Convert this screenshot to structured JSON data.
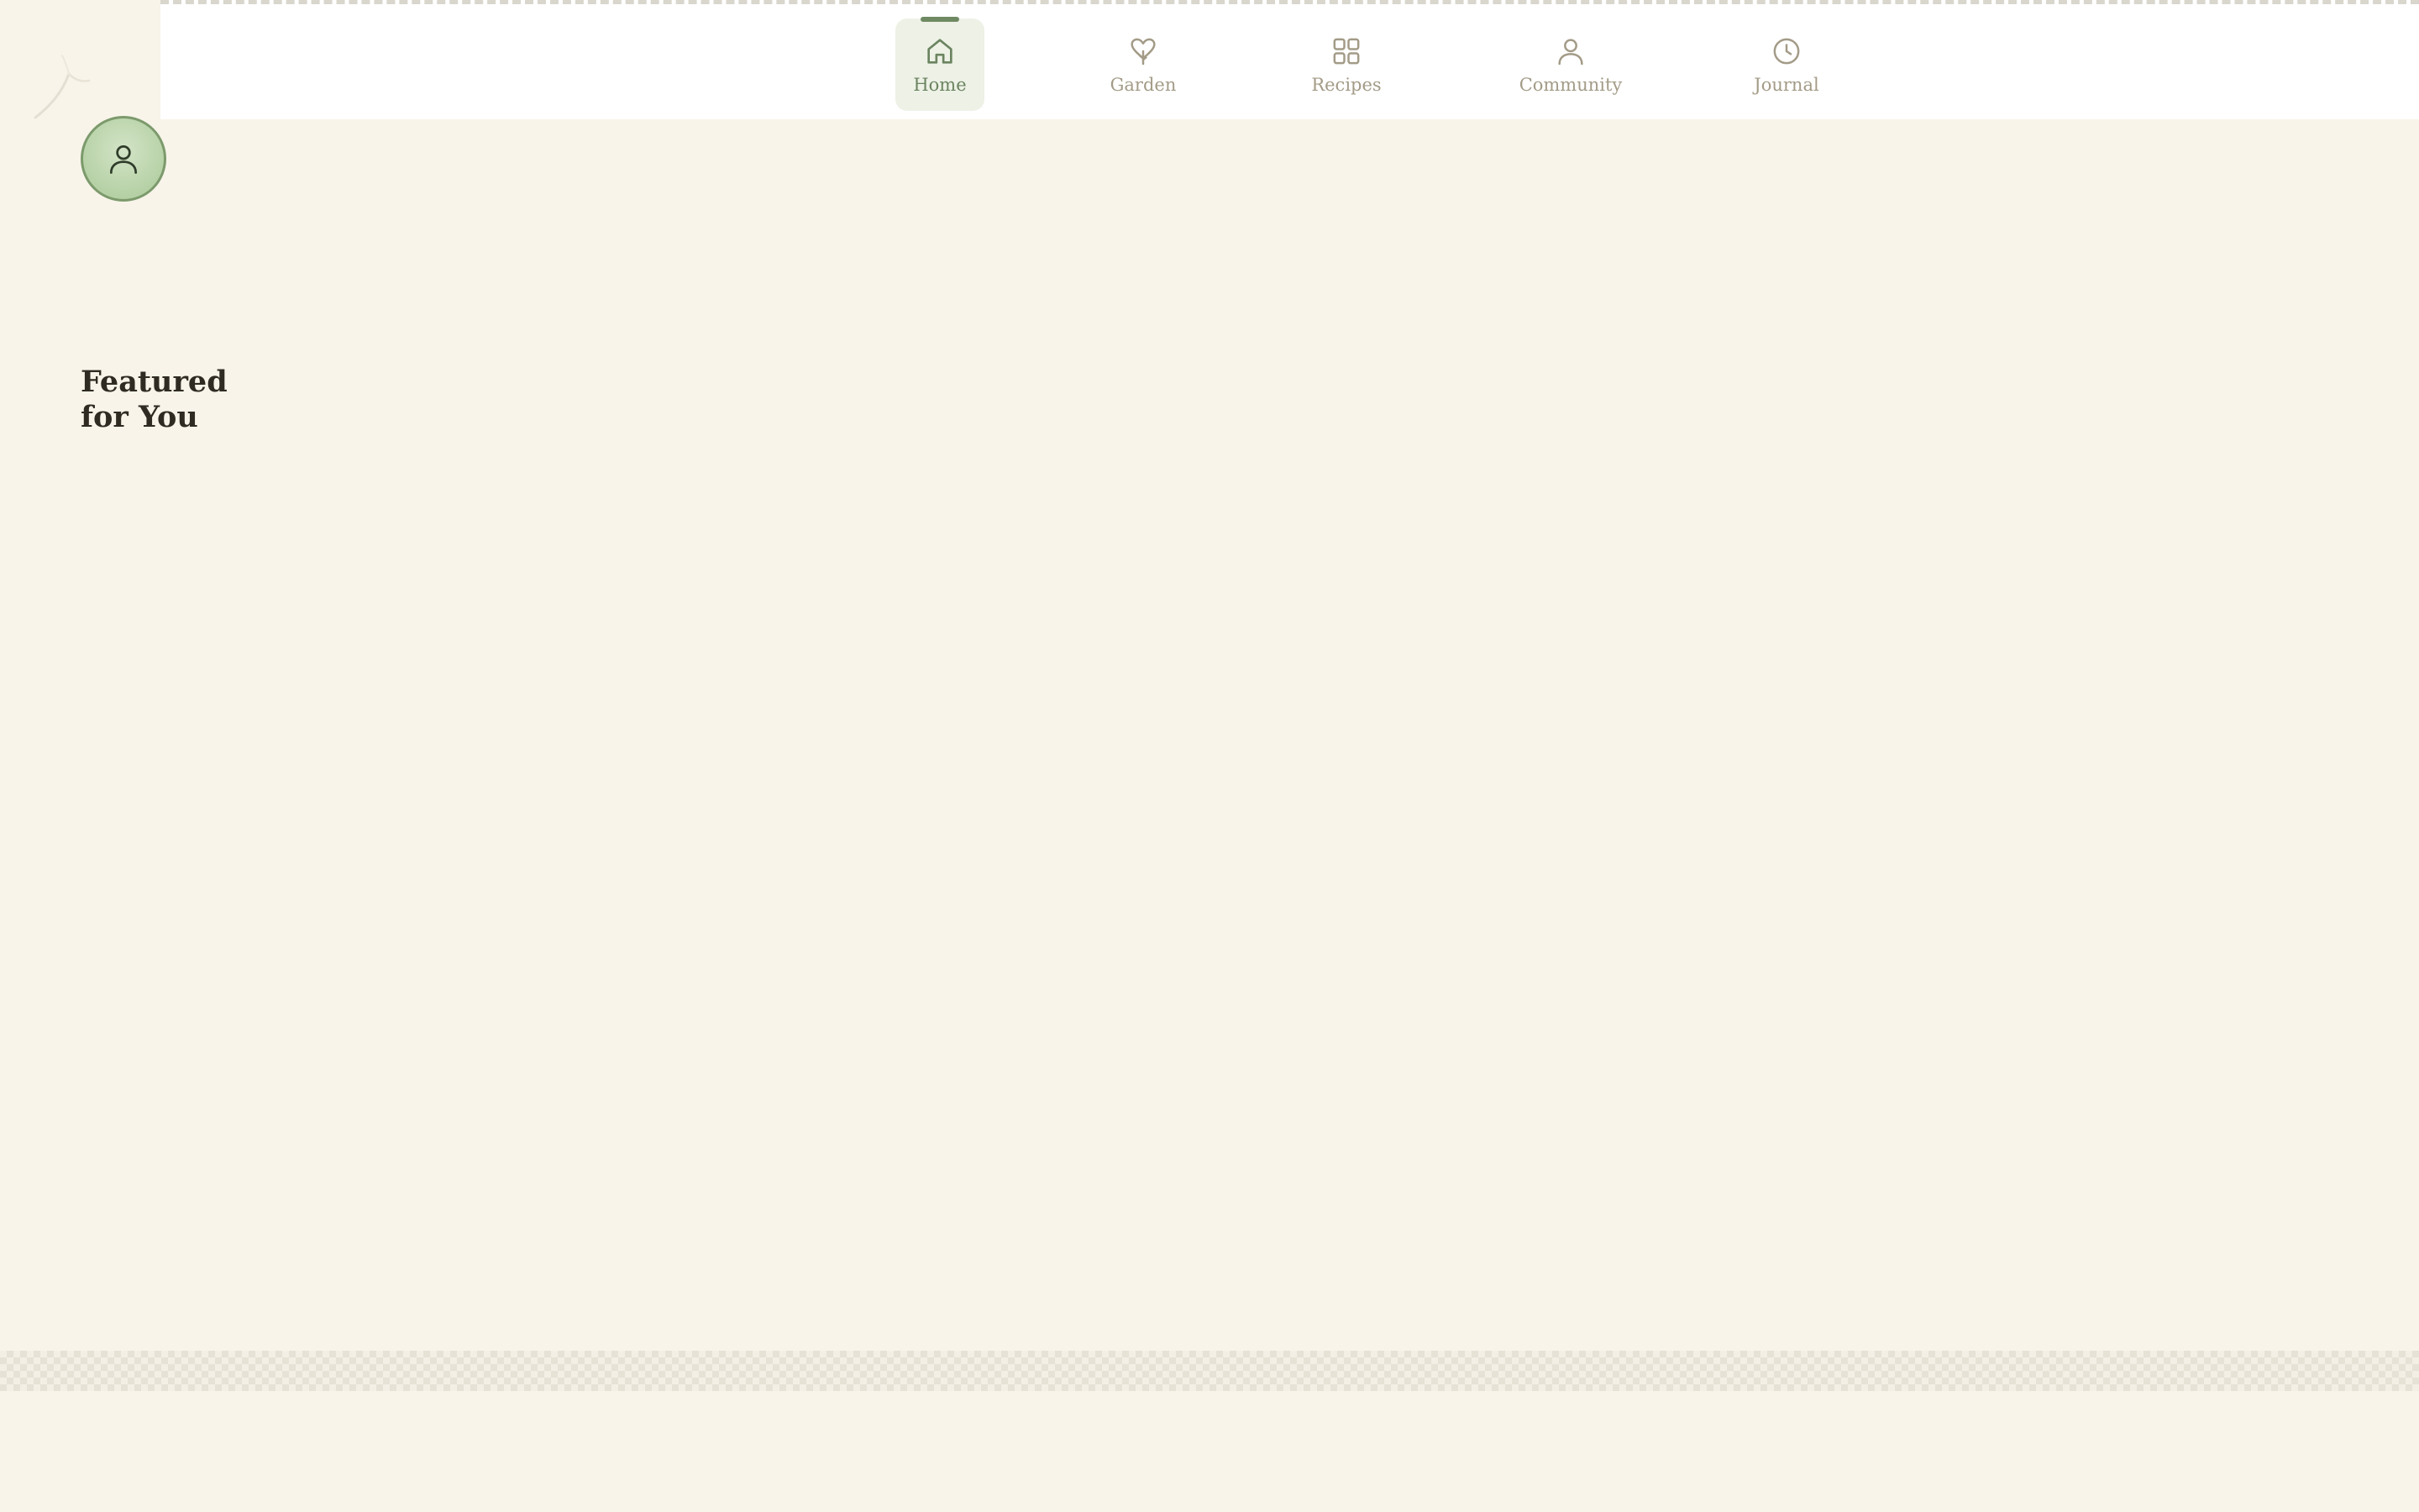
{
  "nav": {
    "items": [
      {
        "label": "Home",
        "icon": "home-icon",
        "active": true
      },
      {
        "label": "Garden",
        "icon": "heart-sprout-icon",
        "active": false
      },
      {
        "label": "Recipes",
        "icon": "grid-icon",
        "active": false
      },
      {
        "label": "Community",
        "icon": "person-icon",
        "active": false
      },
      {
        "label": "Journal",
        "icon": "clock-icon",
        "active": false
      }
    ]
  },
  "main": {
    "featured_title": "Featured for You"
  },
  "colors": {
    "background": "#f8f4ea",
    "accent": "#6f8a63",
    "nav_active_bg": "#edf1e6",
    "nav_inactive_text": "#a39b87",
    "title_text": "#2f2a22"
  }
}
